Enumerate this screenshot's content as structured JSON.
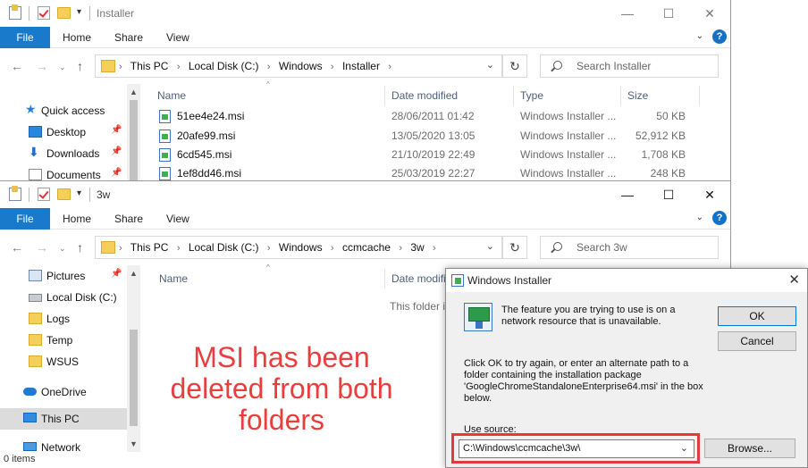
{
  "window1": {
    "title": "Installer",
    "ribbon": {
      "file": "File",
      "home": "Home",
      "share": "Share",
      "view": "View"
    },
    "breadcrumb": [
      "This PC",
      "Local Disk (C:)",
      "Windows",
      "Installer"
    ],
    "search_placeholder": "Search Installer",
    "sidebar": [
      {
        "label": "Quick access",
        "icon": "star-icon"
      },
      {
        "label": "Desktop",
        "icon": "desktop-icon",
        "pinned": true
      },
      {
        "label": "Downloads",
        "icon": "downloads-icon",
        "pinned": true
      },
      {
        "label": "Documents",
        "icon": "documents-icon",
        "pinned": true
      }
    ],
    "columns": {
      "name": "Name",
      "date": "Date modified",
      "type": "Type",
      "size": "Size"
    },
    "files": [
      {
        "name": "51ee4e24.msi",
        "date": "28/06/2011 01:42",
        "type": "Windows Installer ...",
        "size": "50 KB"
      },
      {
        "name": "20afe99.msi",
        "date": "13/05/2020 13:05",
        "type": "Windows Installer ...",
        "size": "52,912 KB"
      },
      {
        "name": "6cd545.msi",
        "date": "21/10/2019 22:49",
        "type": "Windows Installer ...",
        "size": "1,708 KB"
      },
      {
        "name": "1ef8dd46.msi",
        "date": "25/03/2019 22:27",
        "type": "Windows Installer ...",
        "size": "248 KB"
      }
    ]
  },
  "window2": {
    "title": "3w",
    "ribbon": {
      "file": "File",
      "home": "Home",
      "share": "Share",
      "view": "View"
    },
    "breadcrumb": [
      "This PC",
      "Local Disk (C:)",
      "Windows",
      "ccmcache",
      "3w"
    ],
    "search_placeholder": "Search 3w",
    "sidebar": [
      {
        "label": "Pictures",
        "icon": "pictures-icon",
        "pinned": true
      },
      {
        "label": "Local Disk (C:)",
        "icon": "disk-icon"
      },
      {
        "label": "Logs",
        "icon": "folder-icon"
      },
      {
        "label": "Temp",
        "icon": "folder-icon"
      },
      {
        "label": "WSUS",
        "icon": "folder-icon"
      },
      {
        "label": "OneDrive",
        "icon": "onedrive-icon"
      },
      {
        "label": "This PC",
        "icon": "this-pc-icon",
        "selected": true
      },
      {
        "label": "Network",
        "icon": "network-icon"
      }
    ],
    "columns": {
      "name": "Name",
      "date": "Date modified"
    },
    "empty_message": "This folder is",
    "status": "0 items"
  },
  "dialog": {
    "title": "Windows Installer",
    "message": "The feature you are trying to use is on a network resource that is unavailable.",
    "instruction": "Click OK to try again, or enter an alternate path to a folder containing the installation package 'GoogleChromeStandaloneEnterprise64.msi' in the box below.",
    "use_source_label": "Use source:",
    "use_source_value": "C:\\Windows\\ccmcache\\3w\\",
    "ok_label": "OK",
    "cancel_label": "Cancel",
    "browse_label": "Browse..."
  },
  "annotation": {
    "lines": [
      "MSI has been",
      "deleted from both",
      "folders"
    ],
    "color": "#e83e3e"
  },
  "colors": {
    "accent": "#1979ca",
    "highlight_outline": "#e0393e"
  }
}
